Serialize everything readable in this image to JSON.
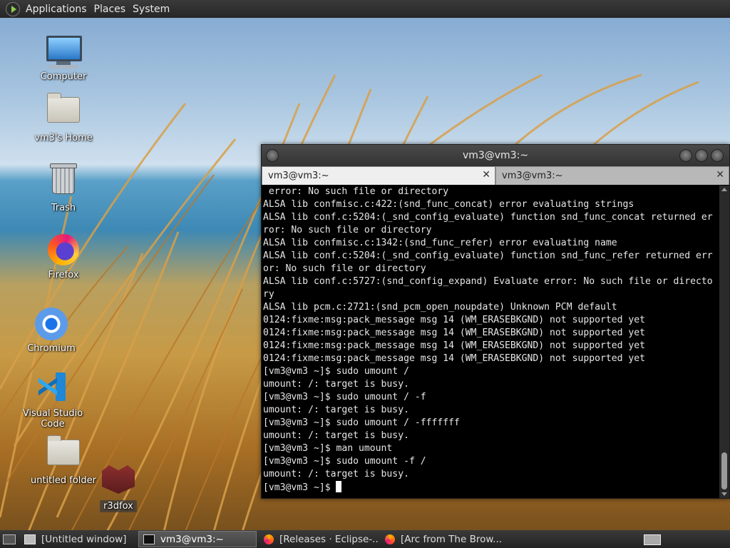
{
  "top_panel": {
    "menus": [
      "Applications",
      "Places",
      "System"
    ]
  },
  "desktop": {
    "icons": [
      {
        "label": "Computer",
        "icon": "computer-icon"
      },
      {
        "label": "vm3's Home",
        "icon": "home-folder-icon"
      },
      {
        "label": "Trash",
        "icon": "trash-icon"
      },
      {
        "label": "Firefox",
        "icon": "firefox-icon"
      },
      {
        "label": "Chromium",
        "icon": "chromium-icon"
      },
      {
        "label": "Visual Studio Code",
        "icon": "vscode-icon"
      },
      {
        "label": "untitled folder",
        "icon": "folder-icon"
      },
      {
        "label": "r3dfox",
        "icon": "r3dfox-icon"
      }
    ]
  },
  "terminal": {
    "title": "vm3@vm3:~",
    "tabs": [
      {
        "label": "vm3@vm3:~",
        "active": true
      },
      {
        "label": "vm3@vm3:~",
        "active": false
      }
    ],
    "lines": [
      " error: No such file or directory",
      "ALSA lib confmisc.c:422:(snd_func_concat) error evaluating strings",
      "ALSA lib conf.c:5204:(_snd_config_evaluate) function snd_func_concat returned er",
      "ror: No such file or directory",
      "ALSA lib confmisc.c:1342:(snd_func_refer) error evaluating name",
      "ALSA lib conf.c:5204:(_snd_config_evaluate) function snd_func_refer returned err",
      "or: No such file or directory",
      "ALSA lib conf.c:5727:(snd_config_expand) Evaluate error: No such file or directo",
      "ry",
      "ALSA lib pcm.c:2721:(snd_pcm_open_noupdate) Unknown PCM default",
      "0124:fixme:msg:pack_message msg 14 (WM_ERASEBKGND) not supported yet",
      "0124:fixme:msg:pack_message msg 14 (WM_ERASEBKGND) not supported yet",
      "0124:fixme:msg:pack_message msg 14 (WM_ERASEBKGND) not supported yet",
      "0124:fixme:msg:pack_message msg 14 (WM_ERASEBKGND) not supported yet",
      "[vm3@vm3 ~]$ sudo umount /",
      "umount: /: target is busy.",
      "[vm3@vm3 ~]$ sudo umount / -f",
      "umount: /: target is busy.",
      "[vm3@vm3 ~]$ sudo umount / -fffffff",
      "umount: /: target is busy.",
      "[vm3@vm3 ~]$ man umount",
      "[vm3@vm3 ~]$ sudo umount -f /",
      "umount: /: target is busy."
    ],
    "prompt": "[vm3@vm3 ~]$ "
  },
  "taskbar": {
    "tasks": [
      {
        "label": "[Untitled window]",
        "icon": "window-icon",
        "active": false
      },
      {
        "label": "vm3@vm3:~",
        "icon": "terminal-icon",
        "active": true
      },
      {
        "label": "[Releases · Eclipse-...",
        "icon": "firefox-icon",
        "active": false
      },
      {
        "label": "[Arc from The Brow...",
        "icon": "firefox-icon",
        "active": false
      }
    ]
  }
}
